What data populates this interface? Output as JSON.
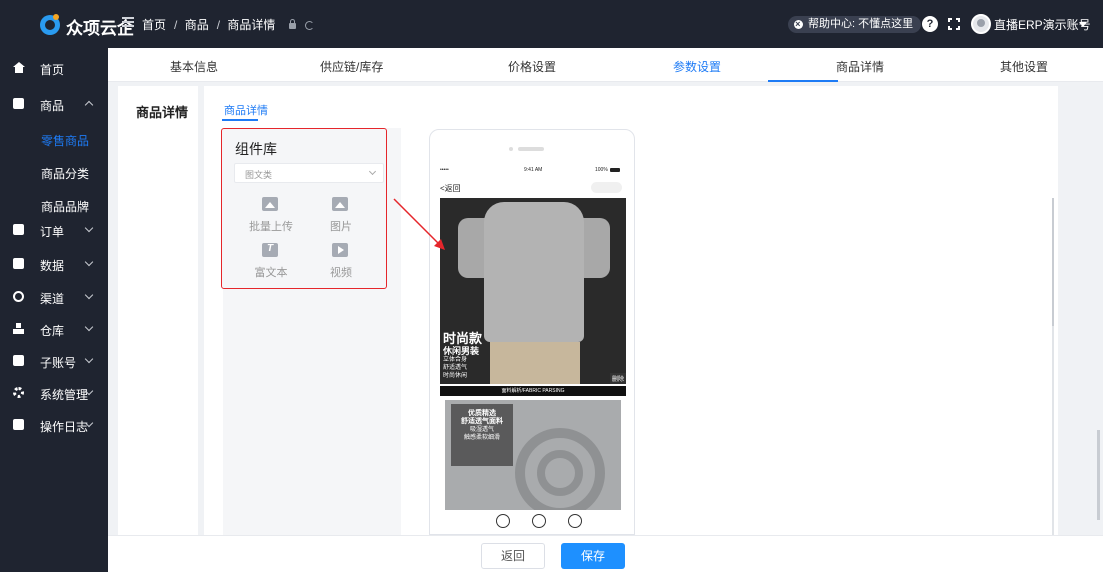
{
  "app": {
    "brand": "众项云企"
  },
  "breadcrumb": [
    "首页",
    "商品",
    "商品详情"
  ],
  "topbar": {
    "help": "帮助中心: 不懂点这里",
    "help_glyph": "?",
    "account": "直播ERP演示账号"
  },
  "sidebar": {
    "items": [
      {
        "label": "首页",
        "icon": "home-icon"
      },
      {
        "label": "商品",
        "icon": "product-icon"
      },
      {
        "label": "订单",
        "icon": "order-icon"
      },
      {
        "label": "数据",
        "icon": "data-icon"
      },
      {
        "label": "渠道",
        "icon": "channel-icon"
      },
      {
        "label": "仓库",
        "icon": "warehouse-icon"
      },
      {
        "label": "子账号",
        "icon": "subaccount-icon"
      },
      {
        "label": "系统管理",
        "icon": "gear-icon"
      },
      {
        "label": "操作日志",
        "icon": "log-icon"
      }
    ],
    "sub_items": [
      {
        "label": "零售商品",
        "active": true
      },
      {
        "label": "商品分类"
      },
      {
        "label": "商品品牌"
      }
    ]
  },
  "tabs": [
    {
      "label": "基本信息"
    },
    {
      "label": "供应链/库存"
    },
    {
      "label": "价格设置"
    },
    {
      "label": "参数设置",
      "active": true
    },
    {
      "label": "商品详情"
    },
    {
      "label": "其他设置"
    }
  ],
  "section": {
    "title": "商品详情",
    "subtab": "商品详情"
  },
  "library": {
    "title": "组件库",
    "category": "图文类",
    "tools": [
      {
        "label": "批量上传",
        "icon": "upload-image-icon"
      },
      {
        "label": "图片",
        "icon": "image-icon"
      },
      {
        "label": "富文本",
        "icon": "text-icon"
      },
      {
        "label": "视频",
        "icon": "video-icon"
      }
    ]
  },
  "preview": {
    "signal": "•••••",
    "time": "9:41 AM",
    "battery": "100%",
    "back": "返回",
    "promo_title": "时尚款",
    "promo_sub": "休闲男装",
    "promo_points": [
      "立体合身",
      "舒适透气",
      "时尚休闲"
    ],
    "delete": "删除",
    "fabric_bar": "面料解析/FABRIC PARSING",
    "card_title": "优质精选",
    "card_sub": "舒适透气面料",
    "card_points": [
      "吸湿透气",
      "触感柔软细滑"
    ]
  },
  "footer": {
    "back": "返回",
    "save": "保存"
  },
  "colors": {
    "accent": "#1e7bf5",
    "highlight": "#e5262b",
    "sidebar_bg": "#1f2430",
    "save_bg": "#1e90ff"
  }
}
